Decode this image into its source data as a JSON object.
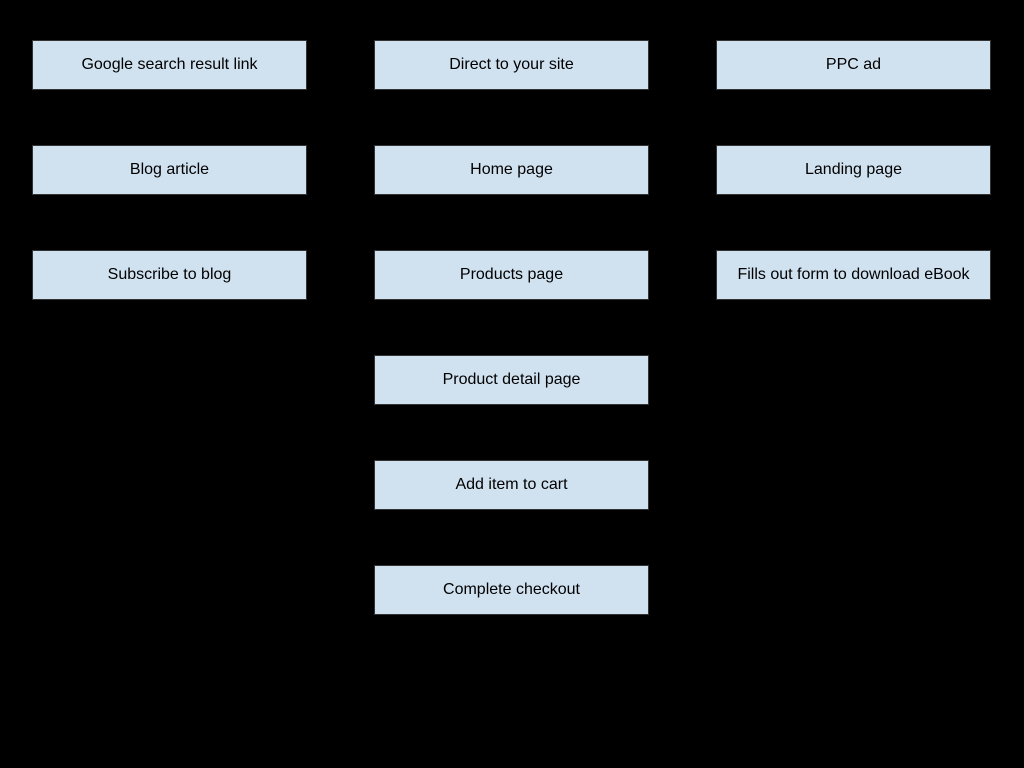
{
  "nodes": {
    "a1": "Google search result link",
    "a2": "Direct to your site",
    "a3": "PPC ad",
    "b1": "Blog article",
    "b2": "Home page",
    "b3": "Landing page",
    "c1": "Subscribe to blog",
    "c2": "Products page",
    "c3": "Fills out form to download eBook",
    "d2": "Product detail page",
    "e2": "Add item to cart",
    "f2": "Complete checkout"
  }
}
